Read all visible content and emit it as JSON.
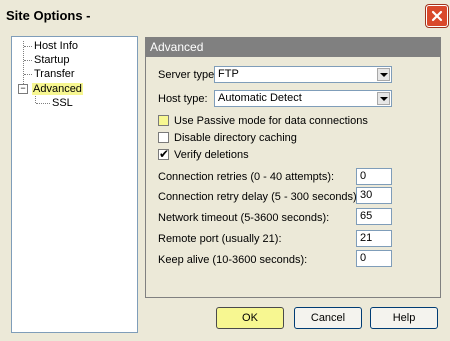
{
  "window": {
    "title": "Site Options -"
  },
  "tree": {
    "items": [
      {
        "label": "Host Info"
      },
      {
        "label": "Startup"
      },
      {
        "label": "Transfer"
      },
      {
        "label": "Advanced",
        "expander": "−"
      },
      {
        "label": "SSL"
      }
    ]
  },
  "panel": {
    "header": "Advanced",
    "server_type": {
      "label": "Server type:",
      "value": "FTP"
    },
    "host_type": {
      "label": "Host type:",
      "value": "Automatic Detect"
    },
    "checkboxes": [
      {
        "label": "Use Passive mode for data connections",
        "checked": false
      },
      {
        "label": "Disable directory caching",
        "checked": false
      },
      {
        "label": "Verify deletions",
        "checked": true,
        "mark": "✔"
      }
    ],
    "fields": [
      {
        "label": "Connection retries (0 - 40 attempts):",
        "value": "0"
      },
      {
        "label": "Connection retry delay (5 - 300 seconds):",
        "value": "30"
      },
      {
        "label": "Network timeout (5-3600 seconds):",
        "value": "65"
      },
      {
        "label": "Remote port (usually 21):",
        "value": "21"
      },
      {
        "label": "Keep alive (10-3600 seconds):",
        "value": "0"
      }
    ]
  },
  "buttons": {
    "ok": "OK",
    "cancel": "Cancel",
    "help": "Help"
  },
  "colors": {
    "highlight": "#f7f791",
    "close": "#d9492b",
    "header": "#808080"
  }
}
